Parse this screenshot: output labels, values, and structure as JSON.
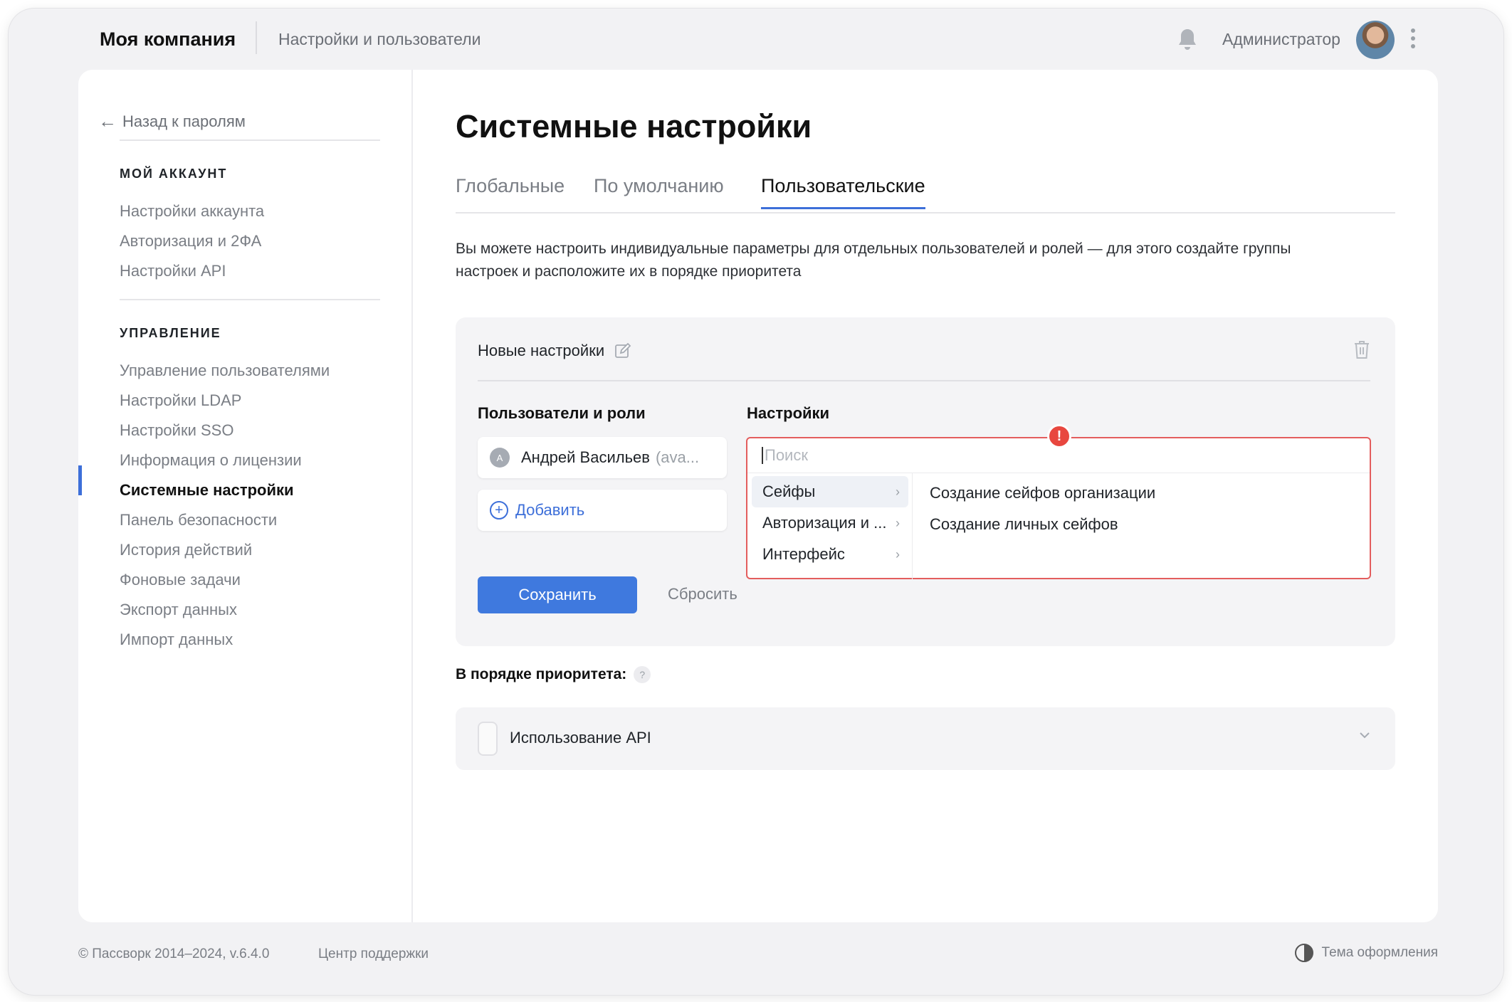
{
  "topbar": {
    "company": "Моя компания",
    "section": "Настройки и пользователи",
    "user_name": "Администратор"
  },
  "sidebar": {
    "back_label": "Назад к паролям",
    "groups": [
      {
        "heading": "МОЙ АККАУНТ",
        "items": [
          {
            "label": "Настройки аккаунта"
          },
          {
            "label": "Авторизация и 2ФА"
          },
          {
            "label": "Настройки API"
          }
        ]
      },
      {
        "heading": "УПРАВЛЕНИЕ",
        "items": [
          {
            "label": "Управление пользователями"
          },
          {
            "label": "Настройки LDAP"
          },
          {
            "label": "Настройки SSO"
          },
          {
            "label": "Информация о лицензии"
          },
          {
            "label": "Системные настройки",
            "active": true
          },
          {
            "label": "Панель безопасности"
          },
          {
            "label": "История действий"
          },
          {
            "label": "Фоновые задачи"
          },
          {
            "label": "Экспорт данных"
          },
          {
            "label": "Импорт данных"
          }
        ]
      }
    ]
  },
  "main": {
    "title": "Системные настройки",
    "tabs": [
      {
        "label": "Глобальные"
      },
      {
        "label": "По умолчанию"
      },
      {
        "label": "Пользовательские",
        "active": true
      }
    ],
    "description": "Вы можете настроить индивидуальные параметры для отдельных пользователей и ролей — для этого создайте группы настроек и расположите их в порядке приоритета",
    "group": {
      "name": "Новые настройки",
      "users_heading": "Пользователи и роли",
      "settings_heading": "Настройки",
      "user": {
        "initial": "А",
        "name": "Андрей Васильев",
        "login": "(ava..."
      },
      "add_label": "Добавить",
      "save_label": "Сохранить",
      "reset_label": "Сбросить",
      "error_mark": "!",
      "search_placeholder": "Поиск",
      "categories": [
        {
          "label": "Сейфы",
          "active": true
        },
        {
          "label": "Авторизация и ..."
        },
        {
          "label": "Интерфейс"
        }
      ],
      "options": [
        {
          "label": "Создание сейфов организации"
        },
        {
          "label": "Создание личных сейфов"
        }
      ]
    },
    "priority": {
      "label": "В порядке приоритета:",
      "help": "?",
      "items": [
        {
          "label": "Использование API"
        }
      ]
    }
  },
  "footer": {
    "copyright": "© Пассворк 2014–2024, v.6.4.0",
    "support": "Центр поддержки",
    "theme": "Тема оформления"
  },
  "colors": {
    "accent": "#3d6fd9",
    "save_button": "#3f79de",
    "error": "#e8473f",
    "error_border": "#e35d5d",
    "window_bg": "#f2f2f4"
  }
}
